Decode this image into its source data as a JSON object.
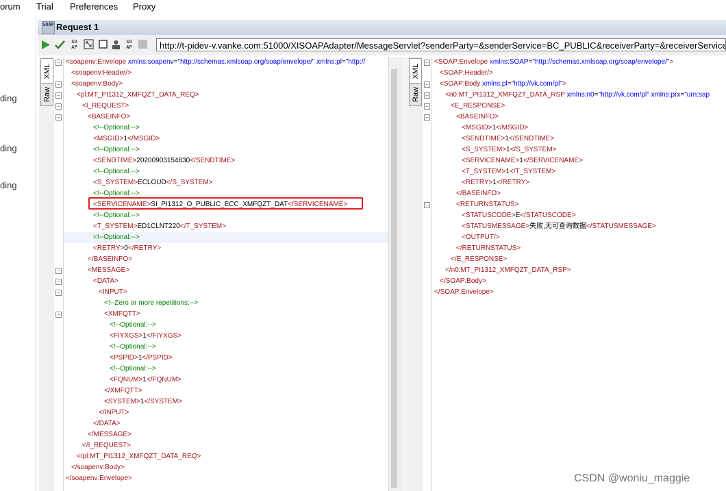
{
  "menu": [
    "orum",
    "Trial",
    "Preferences",
    "Proxy"
  ],
  "left_panel": [
    "ding",
    "ding",
    "ding"
  ],
  "request": {
    "badge": "SOAP",
    "title": "Request 1"
  },
  "toolbar": {
    "icons": [
      "submit-play-icon",
      "validate-check-icon",
      "soap-icon",
      "resize-icon",
      "stop-square-icon",
      "profile-icon",
      "options-icon",
      "grey-square-icon"
    ],
    "endpoint": "http://t-pidev-v.vanke.com:51000/XISOAPAdapter/MessageServlet?senderParty=&senderService=BC_PUBLIC&receiverParty=&receiverService=&"
  },
  "tabs": {
    "xml": "XML",
    "raw": "Raw"
  },
  "colors": {
    "tag": "#a3151a",
    "attr": "#0000ff",
    "attr_value": "#0000ff",
    "comment": "#008000",
    "text": "#000000",
    "highlight_box": "#e02020"
  },
  "request_lines": [
    {
      "indent": 0,
      "fold": "minus",
      "tokens": [
        {
          "t": "<",
          "c": "tag"
        },
        {
          "t": "soapenv:Envelope",
          "c": "tag"
        },
        {
          "t": " xmlns:soapenv",
          "c": "attr"
        },
        {
          "t": "=",
          "c": "text"
        },
        {
          "t": "\"http://schemas.xmlsoap.org/soap/envelope/\"",
          "c": "attr_value"
        },
        {
          "t": " xmlns:pl",
          "c": "attr"
        },
        {
          "t": "=",
          "c": "text"
        },
        {
          "t": "\"http://",
          "c": "attr_value"
        }
      ]
    },
    {
      "indent": 1,
      "fold": "",
      "tokens": [
        {
          "t": "<soapenv:Header/>",
          "c": "tag"
        }
      ]
    },
    {
      "indent": 1,
      "fold": "minus",
      "tokens": [
        {
          "t": "<soapenv:Body>",
          "c": "tag"
        }
      ]
    },
    {
      "indent": 2,
      "fold": "minus",
      "tokens": [
        {
          "t": "<pl:MT_PI1312_XMFQZT_DATA_REQ>",
          "c": "tag"
        }
      ]
    },
    {
      "indent": 3,
      "fold": "minus",
      "tokens": [
        {
          "t": "<I_REQUEST>",
          "c": "tag"
        }
      ]
    },
    {
      "indent": 4,
      "fold": "minus",
      "tokens": [
        {
          "t": "<BASEINFO>",
          "c": "tag"
        }
      ]
    },
    {
      "indent": 5,
      "fold": "",
      "tokens": [
        {
          "t": "<!--Optional:-->",
          "c": "comment"
        }
      ]
    },
    {
      "indent": 5,
      "fold": "",
      "tokens": [
        {
          "t": "<MSGID>",
          "c": "tag"
        },
        {
          "t": "1",
          "c": "text"
        },
        {
          "t": "</MSGID>",
          "c": "tag"
        }
      ]
    },
    {
      "indent": 5,
      "fold": "",
      "tokens": [
        {
          "t": "<!--Optional:-->",
          "c": "comment"
        }
      ]
    },
    {
      "indent": 5,
      "fold": "",
      "tokens": [
        {
          "t": "<SENDTIME>",
          "c": "tag"
        },
        {
          "t": "20200903154830",
          "c": "text"
        },
        {
          "t": "</SENDTIME>",
          "c": "tag"
        }
      ]
    },
    {
      "indent": 5,
      "fold": "",
      "tokens": [
        {
          "t": "<!--Optional:-->",
          "c": "comment"
        }
      ]
    },
    {
      "indent": 5,
      "fold": "",
      "tokens": [
        {
          "t": "<S_SYSTEM>",
          "c": "tag"
        },
        {
          "t": "ECLOUD",
          "c": "text"
        },
        {
          "t": "</S_SYSTEM>",
          "c": "tag"
        }
      ]
    },
    {
      "indent": 5,
      "fold": "",
      "tokens": [
        {
          "t": "<!--Optional:-->",
          "c": "comment"
        }
      ]
    },
    {
      "indent": 5,
      "fold": "",
      "tokens": [
        {
          "t": "<SERVICENAME>",
          "c": "tag"
        },
        {
          "t": "SI_PI1312_O_PUBLIC_ECC_XMFQZT_DAT",
          "c": "text"
        },
        {
          "t": "</SERVICENAME>",
          "c": "tag"
        }
      ]
    },
    {
      "indent": 5,
      "fold": "",
      "tokens": [
        {
          "t": "<!--Optional:-->",
          "c": "comment"
        }
      ]
    },
    {
      "indent": 5,
      "fold": "",
      "tokens": [
        {
          "t": "<T_SYSTEM>",
          "c": "tag"
        },
        {
          "t": "ED1CLNT220",
          "c": "text"
        },
        {
          "t": "</T_SYSTEM>",
          "c": "tag"
        }
      ]
    },
    {
      "indent": 5,
      "fold": "",
      "hl": true,
      "tokens": [
        {
          "t": "<!--Optional:-->",
          "c": "comment"
        }
      ]
    },
    {
      "indent": 5,
      "fold": "",
      "tokens": [
        {
          "t": "<RETRY>",
          "c": "tag"
        },
        {
          "t": "0",
          "c": "text"
        },
        {
          "t": "</RETRY>",
          "c": "tag"
        }
      ]
    },
    {
      "indent": 4,
      "fold": "",
      "tokens": [
        {
          "t": "</BASEINFO>",
          "c": "tag"
        }
      ]
    },
    {
      "indent": 4,
      "fold": "minus",
      "tokens": [
        {
          "t": "<MESSAGE>",
          "c": "tag"
        }
      ]
    },
    {
      "indent": 5,
      "fold": "minus",
      "tokens": [
        {
          "t": "<DATA>",
          "c": "tag"
        }
      ]
    },
    {
      "indent": 6,
      "fold": "minus",
      "tokens": [
        {
          "t": "<INPUT>",
          "c": "tag"
        }
      ]
    },
    {
      "indent": 7,
      "fold": "",
      "tokens": [
        {
          "t": "<!--Zero or more repetitions:-->",
          "c": "comment"
        }
      ]
    },
    {
      "indent": 7,
      "fold": "minus",
      "tokens": [
        {
          "t": "<XMFQTT>",
          "c": "tag"
        }
      ]
    },
    {
      "indent": 8,
      "fold": "",
      "tokens": [
        {
          "t": "<!--Optional:-->",
          "c": "comment"
        }
      ]
    },
    {
      "indent": 8,
      "fold": "",
      "tokens": [
        {
          "t": "<FIYXGS>",
          "c": "tag"
        },
        {
          "t": "1",
          "c": "text"
        },
        {
          "t": "</FIYXGS>",
          "c": "tag"
        }
      ]
    },
    {
      "indent": 8,
      "fold": "",
      "tokens": [
        {
          "t": "<!--Optional:-->",
          "c": "comment"
        }
      ]
    },
    {
      "indent": 8,
      "fold": "",
      "tokens": [
        {
          "t": "<PSPID>",
          "c": "tag"
        },
        {
          "t": "1",
          "c": "text"
        },
        {
          "t": "</PSPID>",
          "c": "tag"
        }
      ]
    },
    {
      "indent": 8,
      "fold": "",
      "tokens": [
        {
          "t": "<!--Optional:-->",
          "c": "comment"
        }
      ]
    },
    {
      "indent": 8,
      "fold": "",
      "tokens": [
        {
          "t": "<FQNUM>",
          "c": "tag"
        },
        {
          "t": "1",
          "c": "text"
        },
        {
          "t": "</FQNUM>",
          "c": "tag"
        }
      ]
    },
    {
      "indent": 7,
      "fold": "",
      "tokens": [
        {
          "t": "</XMFQTT>",
          "c": "tag"
        }
      ]
    },
    {
      "indent": 7,
      "fold": "",
      "tokens": [
        {
          "t": "<SYSTEM>",
          "c": "tag"
        },
        {
          "t": "1",
          "c": "text"
        },
        {
          "t": "</SYSTEM>",
          "c": "tag"
        }
      ]
    },
    {
      "indent": 6,
      "fold": "",
      "tokens": [
        {
          "t": "</INPUT>",
          "c": "tag"
        }
      ]
    },
    {
      "indent": 5,
      "fold": "",
      "tokens": [
        {
          "t": "</DATA>",
          "c": "tag"
        }
      ]
    },
    {
      "indent": 4,
      "fold": "",
      "tokens": [
        {
          "t": "</MESSAGE>",
          "c": "tag"
        }
      ]
    },
    {
      "indent": 3,
      "fold": "",
      "tokens": [
        {
          "t": "</I_REQUEST>",
          "c": "tag"
        }
      ]
    },
    {
      "indent": 2,
      "fold": "",
      "tokens": [
        {
          "t": "</pl:MT_PI1312_XMFQZT_DATA_REQ>",
          "c": "tag"
        }
      ]
    },
    {
      "indent": 1,
      "fold": "",
      "tokens": [
        {
          "t": "</soapenv:Body>",
          "c": "tag"
        }
      ]
    },
    {
      "indent": 0,
      "fold": "",
      "tokens": [
        {
          "t": "</soapenv:Envelope>",
          "c": "tag"
        }
      ]
    }
  ],
  "response_lines": [
    {
      "indent": 0,
      "fold": "minus",
      "tokens": [
        {
          "t": "<SOAP:Envelope",
          "c": "tag"
        },
        {
          "t": " xmlns:SOAP",
          "c": "attr"
        },
        {
          "t": "=",
          "c": "text"
        },
        {
          "t": "\"http://schemas.xmlsoap.org/soap/envelope/\"",
          "c": "attr_value"
        },
        {
          "t": ">",
          "c": "tag"
        }
      ]
    },
    {
      "indent": 1,
      "fold": "",
      "tokens": [
        {
          "t": "<SOAP:Header/>",
          "c": "tag"
        }
      ]
    },
    {
      "indent": 1,
      "fold": "minus",
      "tokens": [
        {
          "t": "<SOAP:Body",
          "c": "tag"
        },
        {
          "t": " xmlns:pl",
          "c": "attr"
        },
        {
          "t": "=",
          "c": "text"
        },
        {
          "t": "\"http://vk.com/pl\"",
          "c": "attr_value"
        },
        {
          "t": ">",
          "c": "tag"
        }
      ]
    },
    {
      "indent": 2,
      "fold": "minus",
      "tokens": [
        {
          "t": "<n0:MT_PI1312_XMFQZT_DATA_RSP",
          "c": "tag"
        },
        {
          "t": " xmlns:n0",
          "c": "attr"
        },
        {
          "t": "=",
          "c": "text"
        },
        {
          "t": "\"http://vk.com/pl\"",
          "c": "attr_value"
        },
        {
          "t": " xmlns:prx",
          "c": "attr"
        },
        {
          "t": "=",
          "c": "text"
        },
        {
          "t": "\"urn:sap",
          "c": "attr_value"
        }
      ]
    },
    {
      "indent": 3,
      "fold": "minus",
      "tokens": [
        {
          "t": "<E_RESPONSE>",
          "c": "tag"
        }
      ]
    },
    {
      "indent": 4,
      "fold": "minus",
      "tokens": [
        {
          "t": "<BASEINFO>",
          "c": "tag"
        }
      ]
    },
    {
      "indent": 5,
      "fold": "",
      "tokens": [
        {
          "t": "<MSGID>",
          "c": "tag"
        },
        {
          "t": "1",
          "c": "text"
        },
        {
          "t": "</MSGID>",
          "c": "tag"
        }
      ]
    },
    {
      "indent": 5,
      "fold": "",
      "tokens": [
        {
          "t": "<SENDTIME>",
          "c": "tag"
        },
        {
          "t": "1",
          "c": "text"
        },
        {
          "t": "</SENDTIME>",
          "c": "tag"
        }
      ]
    },
    {
      "indent": 5,
      "fold": "",
      "tokens": [
        {
          "t": "<S_SYSTEM>",
          "c": "tag"
        },
        {
          "t": "1",
          "c": "text"
        },
        {
          "t": "</S_SYSTEM>",
          "c": "tag"
        }
      ]
    },
    {
      "indent": 5,
      "fold": "",
      "tokens": [
        {
          "t": "<SERVICENAME>",
          "c": "tag"
        },
        {
          "t": "1",
          "c": "text"
        },
        {
          "t": "</SERVICENAME>",
          "c": "tag"
        }
      ]
    },
    {
      "indent": 5,
      "fold": "",
      "tokens": [
        {
          "t": "<T_SYSTEM>",
          "c": "tag"
        },
        {
          "t": "1",
          "c": "text"
        },
        {
          "t": "</T_SYSTEM>",
          "c": "tag"
        }
      ]
    },
    {
      "indent": 5,
      "fold": "",
      "tokens": [
        {
          "t": "<RETRY>",
          "c": "tag"
        },
        {
          "t": "1",
          "c": "text"
        },
        {
          "t": "</RETRY>",
          "c": "tag"
        }
      ]
    },
    {
      "indent": 4,
      "fold": "",
      "tokens": [
        {
          "t": "</BASEINFO>",
          "c": "tag"
        }
      ]
    },
    {
      "indent": 4,
      "fold": "minus",
      "tokens": [
        {
          "t": "<RETURNSTATUS>",
          "c": "tag"
        }
      ]
    },
    {
      "indent": 5,
      "fold": "",
      "tokens": [
        {
          "t": "<STATUSCODE>",
          "c": "tag"
        },
        {
          "t": "E",
          "c": "text"
        },
        {
          "t": "</STATUSCODE>",
          "c": "tag"
        }
      ]
    },
    {
      "indent": 5,
      "fold": "",
      "tokens": [
        {
          "t": "<STATUSMESSAGE>",
          "c": "tag"
        },
        {
          "t": "失败,无可查询数据",
          "c": "text"
        },
        {
          "t": "</STATUSMESSAGE>",
          "c": "tag"
        }
      ]
    },
    {
      "indent": 5,
      "fold": "",
      "tokens": [
        {
          "t": "<OUTPUT/>",
          "c": "tag"
        }
      ]
    },
    {
      "indent": 4,
      "fold": "",
      "tokens": [
        {
          "t": "</RETURNSTATUS>",
          "c": "tag"
        }
      ]
    },
    {
      "indent": 3,
      "fold": "",
      "tokens": [
        {
          "t": "</E_RESPONSE>",
          "c": "tag"
        }
      ]
    },
    {
      "indent": 2,
      "fold": "",
      "tokens": [
        {
          "t": "</n0:MT_PI1312_XMFQZT_DATA_RSP>",
          "c": "tag"
        }
      ]
    },
    {
      "indent": 1,
      "fold": "",
      "tokens": [
        {
          "t": "</SOAP:Body>",
          "c": "tag"
        }
      ]
    },
    {
      "indent": 0,
      "fold": "",
      "tokens": [
        {
          "t": "</SOAP:Envelope>",
          "c": "tag"
        }
      ]
    }
  ],
  "watermark": "CSDN @woniu_maggie"
}
